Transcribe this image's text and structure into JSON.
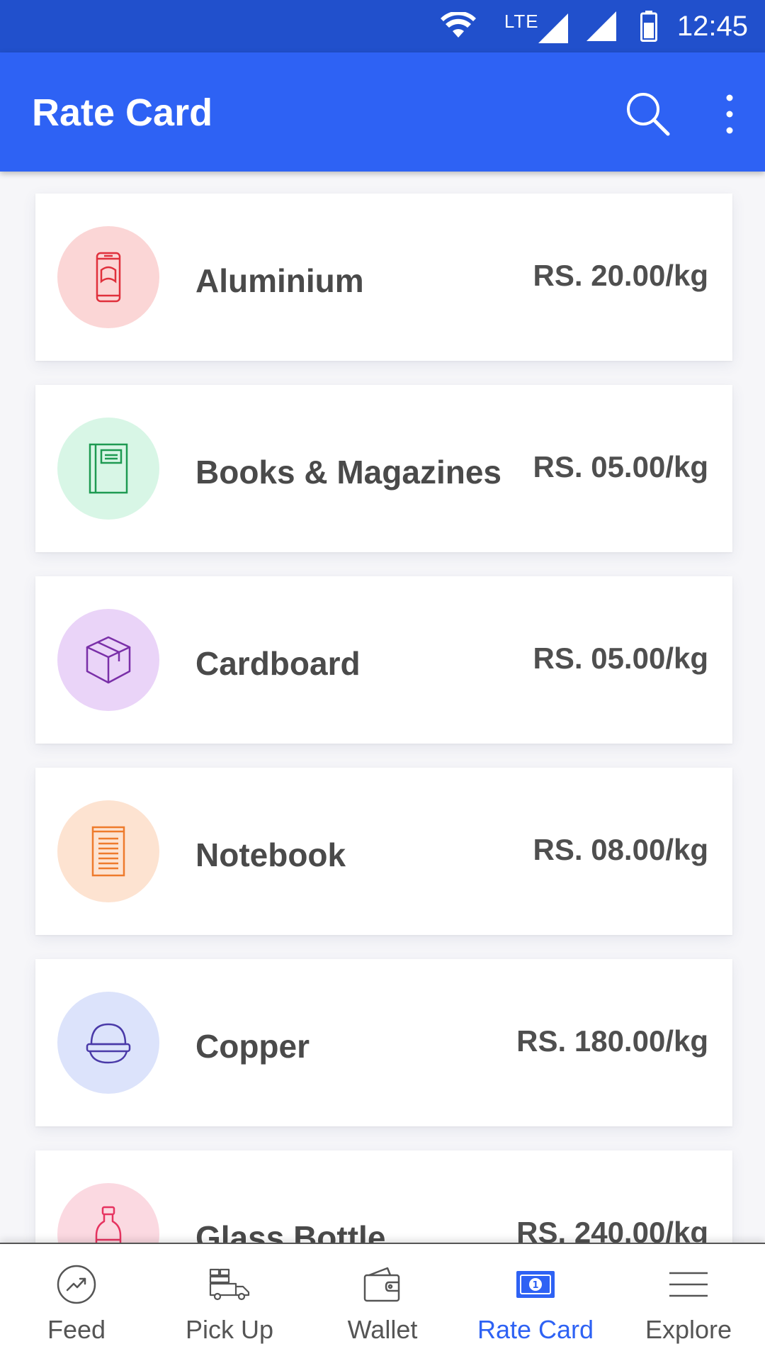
{
  "status_bar": {
    "network_label": "LTE",
    "time": "12:45",
    "icons": [
      "wifi-icon",
      "signal-icon",
      "signal-icon",
      "battery-icon"
    ]
  },
  "app_bar": {
    "title": "Rate Card",
    "actions": [
      "search-icon",
      "more-vert-icon"
    ]
  },
  "rate_items": [
    {
      "name": "Aluminium",
      "rate": "RS. 20.00/kg",
      "icon": "can-icon",
      "badge_color": "#fbd6d6",
      "icon_color": "#e0303c"
    },
    {
      "name": "Books & Magazines",
      "rate": "RS. 05.00/kg",
      "icon": "book-icon",
      "badge_color": "#d8f6e6",
      "icon_color": "#1e9a52"
    },
    {
      "name": "Cardboard",
      "rate": "RS. 05.00/kg",
      "icon": "box-icon",
      "badge_color": "#ead4f8",
      "icon_color": "#7a2fa8"
    },
    {
      "name": "Notebook",
      "rate": "RS. 08.00/kg",
      "icon": "notebook-icon",
      "badge_color": "#fde3d1",
      "icon_color": "#ee7b2c"
    },
    {
      "name": "Copper",
      "rate": "RS. 180.00/kg",
      "icon": "copper-icon",
      "badge_color": "#dce3fb",
      "icon_color": "#4a3aa8"
    },
    {
      "name": "Glass Bottle",
      "rate": "RS. 240.00/kg",
      "icon": "bottle-icon",
      "badge_color": "#fbd9e1",
      "icon_color": "#e63360"
    }
  ],
  "bottom_nav": {
    "active": "Rate Card",
    "accent_color": "#2e62f4",
    "items": [
      {
        "label": "Feed",
        "icon": "trending-icon"
      },
      {
        "label": "Pick Up",
        "icon": "truck-icon"
      },
      {
        "label": "Wallet",
        "icon": "wallet-icon"
      },
      {
        "label": "Rate Card",
        "icon": "money-icon"
      },
      {
        "label": "Explore",
        "icon": "menu-icon"
      }
    ]
  }
}
